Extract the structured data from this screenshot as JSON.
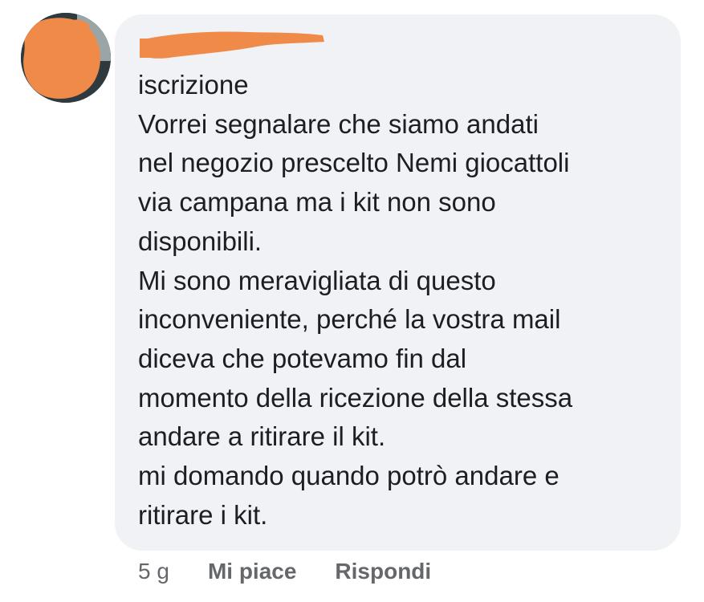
{
  "comment": {
    "author_name": "",
    "body_lines": [
      "iscrizione",
      "Vorrei segnalare che siamo andati",
      "nel negozio prescelto Nemi giocattoli",
      "via campana ma i kit non sono",
      "disponibili.",
      "Mi sono meravigliata di questo",
      "inconveniente, perché la vostra mail",
      "diceva che potevamo fin dal",
      "momento della ricezione della stessa",
      "andare a ritirare il kit.",
      "mi domando quando potrò andare e",
      "ritirare i kit."
    ]
  },
  "meta": {
    "timestamp": "5 g",
    "like_label": "Mi piace",
    "reply_label": "Rispondi"
  },
  "colors": {
    "bubble_background": "#f0f2f5",
    "redaction": "#f08a48",
    "secondary_text": "#65676b"
  }
}
